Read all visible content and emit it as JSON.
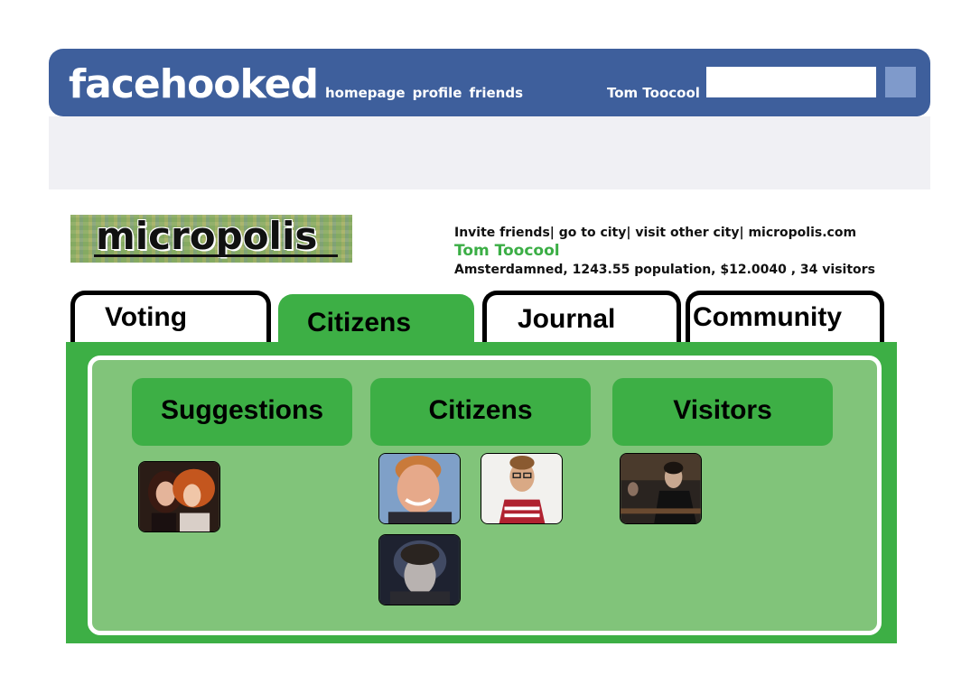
{
  "facehooked": {
    "brand": "facehooked",
    "nav": [
      "homepage",
      "profile",
      "friends"
    ],
    "user_name": "Tom Toocool",
    "search_placeholder": ""
  },
  "app": {
    "logo_text": "micropolis",
    "actions": [
      "Invite friends|",
      "go to city|",
      "visit other city|",
      "micropolis.com"
    ],
    "profile_name": "Tom Toocool",
    "city_stats": "Amsterdamned, 1243.55 population, $12.0040 , 34 visitors"
  },
  "tabs": [
    {
      "label": "Voting",
      "active": false
    },
    {
      "label": "Citizens",
      "active": true
    },
    {
      "label": "Journal",
      "active": false
    },
    {
      "label": "Community",
      "active": false
    }
  ],
  "sections": {
    "suggestions": {
      "label": "Suggestions",
      "avatars": 1
    },
    "citizens": {
      "label": "Citizens",
      "avatars": 3
    },
    "visitors": {
      "label": "Visitors",
      "avatars": 1
    }
  },
  "colors": {
    "header_blue": "#3e5f9c",
    "search_button": "#7f9acb",
    "accent_green": "#3daf45",
    "panel_light_green": "#81c47a",
    "name_green": "#3bae45"
  }
}
